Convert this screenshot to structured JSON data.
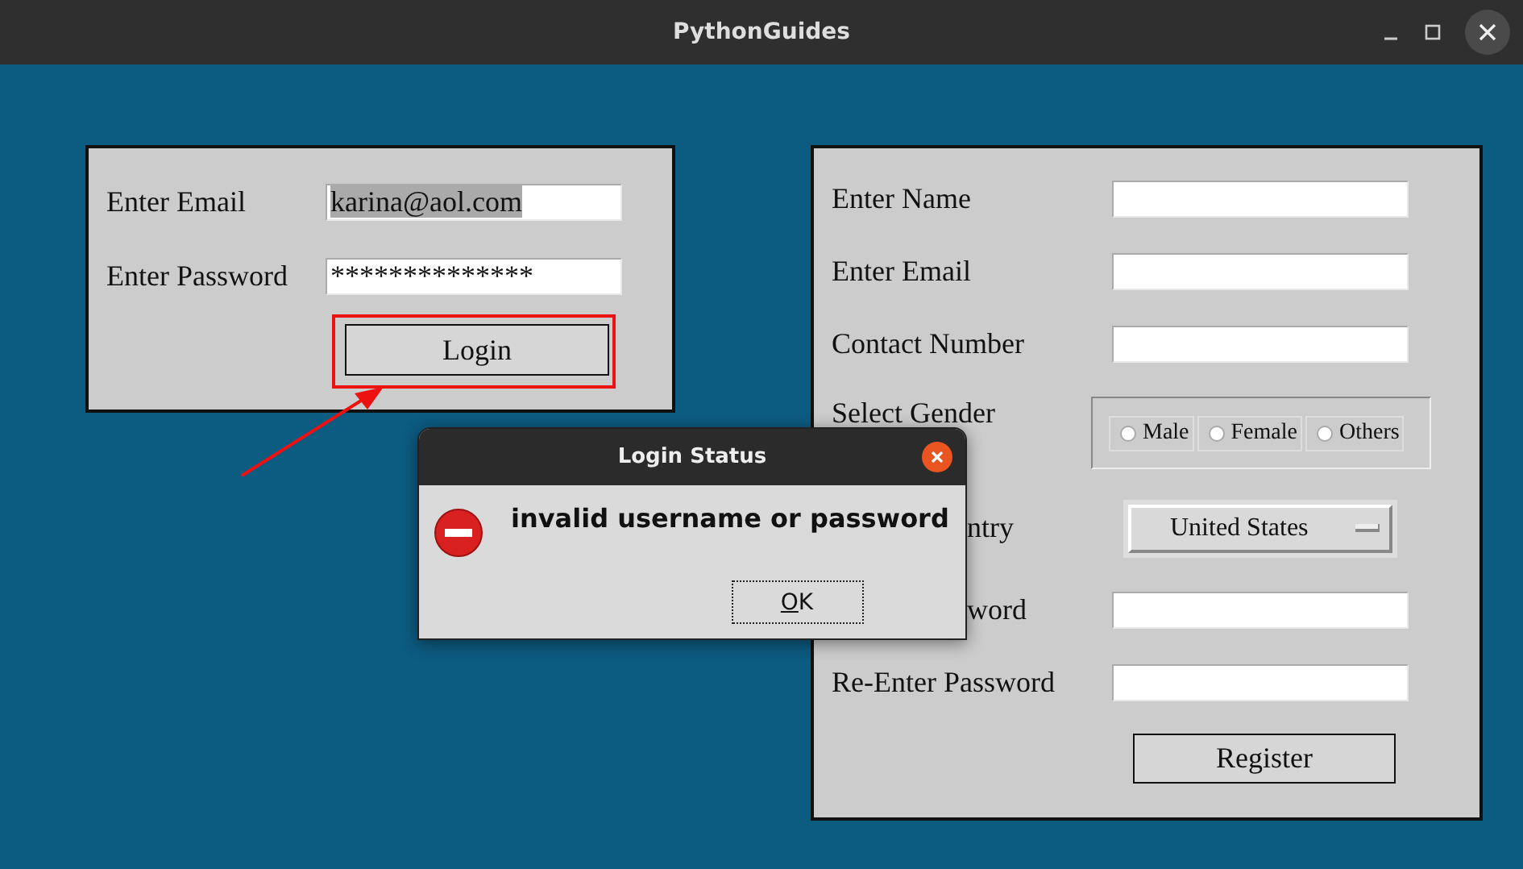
{
  "window": {
    "title": "PythonGuides"
  },
  "login_form": {
    "fields": [
      {
        "label": "Enter Email",
        "value": "karina@aol.com",
        "highlighted_text": true
      },
      {
        "label": "Enter Password",
        "value": "**************",
        "highlighted_text": false
      }
    ],
    "button": "Login"
  },
  "register_form": {
    "rows": [
      {
        "kind": "entry",
        "label": "Enter Name",
        "partly_hidden": false
      },
      {
        "kind": "entry",
        "label": "Enter Email",
        "partly_hidden": false
      },
      {
        "kind": "entry",
        "label": "Contact Number",
        "partly_hidden": false
      },
      {
        "kind": "radio",
        "label": "Select Gender",
        "partly_hidden": false,
        "options": [
          {
            "label": "Male",
            "selected": false
          },
          {
            "label": "Female",
            "selected": false
          },
          {
            "label": "Others",
            "selected": false
          }
        ]
      },
      {
        "kind": "dropdown",
        "label": "ntry",
        "partly_hidden": true,
        "value": "United States"
      },
      {
        "kind": "entry",
        "label": "word",
        "partly_hidden": true
      },
      {
        "kind": "entry",
        "label": "Re-Enter Password",
        "partly_hidden": false
      }
    ],
    "button": "Register"
  },
  "dialog": {
    "title": "Login Status",
    "message": "invalid username or password",
    "button": "OK"
  }
}
